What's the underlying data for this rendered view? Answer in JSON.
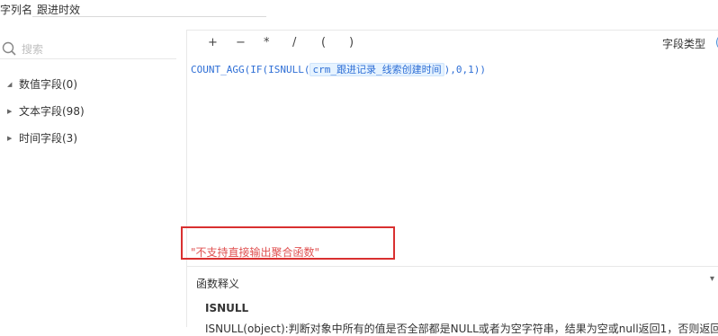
{
  "header": {
    "column_label": "字列名",
    "column_value": "跟进时效"
  },
  "sidebar": {
    "search_placeholder": "搜索",
    "tree": [
      {
        "label": "数值字段(0)",
        "expanded": true
      },
      {
        "label": "文本字段(98)",
        "expanded": false
      },
      {
        "label": "时间字段(3)",
        "expanded": false
      }
    ]
  },
  "toolbar": {
    "operators": [
      "+",
      "−",
      "*",
      "/",
      "(",
      ")"
    ],
    "field_type_label": "字段类型",
    "field_type_trailing": "("
  },
  "editor": {
    "formula_prefix": "COUNT_AGG(IF(ISNULL(",
    "formula_field": "crm_跟进记录_线索创建时间",
    "formula_suffix": "),0,1))"
  },
  "error": {
    "message": "\"不支持直接输出聚合函数\""
  },
  "function_panel": {
    "title": "函数释义",
    "function_name": "ISNULL",
    "description": "ISNULL(object):判断对象中所有的值是否全部都是NULL或者为空字符串，结果为空或null返回1，否则返回"
  },
  "colors": {
    "formula": "#2f6fd6",
    "error": "#e05252",
    "highlight_box": "#d93030"
  }
}
